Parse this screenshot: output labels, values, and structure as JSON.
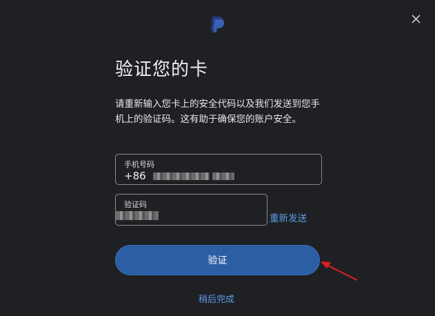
{
  "header": {
    "logo": "paypal-logo-icon",
    "close_icon": "close-icon"
  },
  "title": "验证您的卡",
  "description": "请重新输入您卡上的安全代码以及我们发送到您手机上的验证码。这有助于确保您的账户安全。",
  "phone_field": {
    "label": "手机号码",
    "prefix": "+86"
  },
  "code_field": {
    "label": "验证码"
  },
  "resend_label": "重新发送",
  "verify_button": "验证",
  "later_link": "稍后完成",
  "colors": {
    "accent": "#2b5ea3",
    "link": "#5b9be8",
    "background": "#1f2024",
    "annotation": "#e02020"
  }
}
